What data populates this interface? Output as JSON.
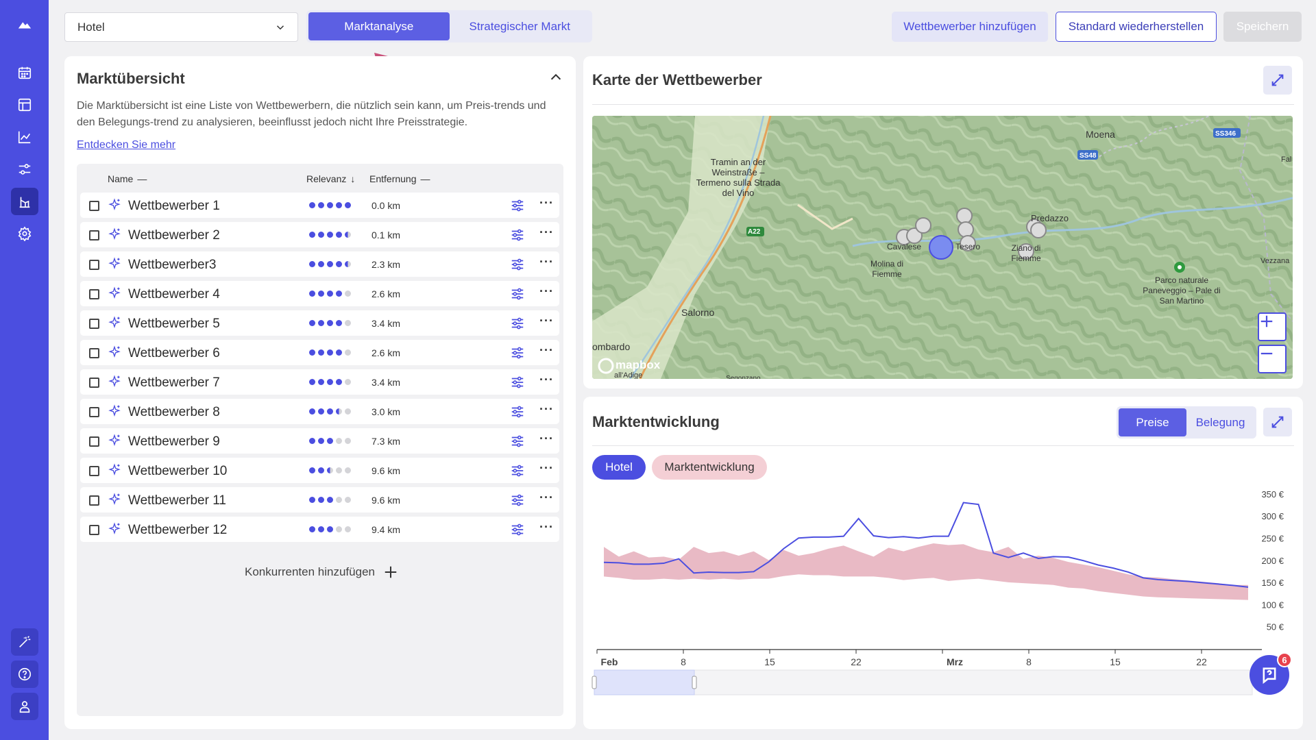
{
  "sidebar": {
    "items": [
      "logo-icon",
      "calendar-icon",
      "layout-icon",
      "chart-line-icon",
      "sliders-icon",
      "market-icon",
      "settings-icon"
    ],
    "bottom": [
      "magic-wand-icon",
      "help-circle-icon",
      "user-icon"
    ]
  },
  "topbar": {
    "hotel_select_value": "Hotel",
    "tabs": [
      {
        "label": "Marktanalyse",
        "active": true
      },
      {
        "label": "Strategischer Markt",
        "active": false
      }
    ],
    "add_competitor_label": "Wettbewerber hinzufügen",
    "restore_label": "Standard wiederherstellen",
    "save_label": "Speichern"
  },
  "overview": {
    "title": "Marktübersicht",
    "description": "Die Marktübersicht ist eine Liste von Wettbewerbern, die nützlich sein kann, um Preis-trends und den Belegungs-trend zu analysieren, beeinflusst jedoch nicht Ihre Preisstrategie.",
    "link": "Entdecken Sie mehr",
    "columns": {
      "name": "Name",
      "relevance": "Relevanz",
      "distance": "Entfernung"
    },
    "competitors": [
      {
        "name": "Wettbewerber 1",
        "relevance": 5,
        "distance": "0.0 km"
      },
      {
        "name": "Wettbewerber 2",
        "relevance": 4.5,
        "distance": "0.1 km"
      },
      {
        "name": "Wettbewerber3",
        "relevance": 4.5,
        "distance": "2.3 km"
      },
      {
        "name": "Wettbewerber 4",
        "relevance": 4,
        "distance": "2.6 km"
      },
      {
        "name": "Wettbewerber 5",
        "relevance": 4,
        "distance": "3.4 km"
      },
      {
        "name": "Wettbewerber 6",
        "relevance": 4,
        "distance": "2.6 km"
      },
      {
        "name": "Wettbewerber 7",
        "relevance": 4,
        "distance": "3.4 km"
      },
      {
        "name": "Wettbewerber 8",
        "relevance": 3.5,
        "distance": "3.0 km"
      },
      {
        "name": "Wettbewerber 9",
        "relevance": 3,
        "distance": "7.3 km"
      },
      {
        "name": "Wettbewerber 10",
        "relevance": 2.5,
        "distance": "9.6 km"
      },
      {
        "name": "Wettbewerber 11",
        "relevance": 3,
        "distance": "9.6 km"
      },
      {
        "name": "Wettbewerber 12",
        "relevance": 3,
        "distance": "9.4 km"
      }
    ],
    "add_label": "Konkurrenten hinzufügen"
  },
  "map": {
    "title": "Karte der Wettbewerber",
    "labels": {
      "moena": "Moena",
      "tramin": "Tramin an der Weinstraße – Termeno sulla Strada del Vino",
      "predazzo": "Predazzo",
      "molina": "Molina di Fiemme",
      "salorno": "Salorno",
      "cavalese": "Cavalese",
      "tesero": "Tesero",
      "ziano": "Ziano di Fiemme",
      "park": "Parco naturale Paneveggio – Pale di San Martino",
      "vezzana": "Vezzana",
      "mezzocorona": "ombardo",
      "segonzano": "Segonzano",
      "adige": "all'Adige",
      "fal": "Fal",
      "a22": "A22",
      "ss48": "SS48",
      "ss346": "SS346",
      "mapbox": "mapbox"
    }
  },
  "trend": {
    "title": "Marktentwicklung",
    "tabs": [
      {
        "label": "Preise",
        "active": true
      },
      {
        "label": "Belegung",
        "active": false
      }
    ],
    "legend_hotel": "Hotel",
    "legend_market": "Marktentwicklung",
    "help_badge": "6"
  },
  "chart_data": {
    "type": "line",
    "x_tick_labels": [
      "Feb",
      "8",
      "15",
      "22",
      "Mrz",
      "8",
      "15",
      "22"
    ],
    "y_tick_labels": [
      "50 €",
      "100 €",
      "150 €",
      "200 €",
      "250 €",
      "300 €",
      "350 €"
    ],
    "ylim": [
      0,
      370
    ],
    "series": [
      {
        "name": "Hotel",
        "color": "#4b4ee0",
        "values": [
          197,
          196,
          193,
          193,
          195,
          205,
          173,
          175,
          174,
          174,
          176,
          198,
          228,
          252,
          254,
          254,
          256,
          296,
          257,
          253,
          255,
          252,
          256,
          256,
          332,
          328,
          218,
          208,
          218,
          206,
          210,
          209,
          201,
          191,
          184,
          175,
          162,
          158,
          156,
          154,
          151,
          148,
          145,
          141
        ]
      },
      {
        "name": "Marktentwicklung",
        "color": "#e5aebb",
        "upper": [
          232,
          210,
          222,
          208,
          210,
          203,
          232,
          218,
          222,
          212,
          222,
          202,
          225,
          212,
          218,
          228,
          235,
          222,
          210,
          230,
          222,
          232,
          240,
          236,
          238,
          226,
          220,
          232,
          205,
          212,
          207,
          198,
          192,
          186,
          178,
          170,
          164,
          163,
          159,
          156,
          153,
          150,
          146,
          146
        ],
        "lower": [
          165,
          162,
          158,
          158,
          160,
          158,
          160,
          158,
          160,
          158,
          160,
          160,
          166,
          170,
          168,
          168,
          165,
          165,
          165,
          162,
          157,
          160,
          162,
          155,
          158,
          160,
          156,
          152,
          150,
          148,
          146,
          140,
          138,
          132,
          128,
          124,
          120,
          118,
          117,
          116,
          115,
          114,
          113,
          112
        ]
      }
    ]
  }
}
